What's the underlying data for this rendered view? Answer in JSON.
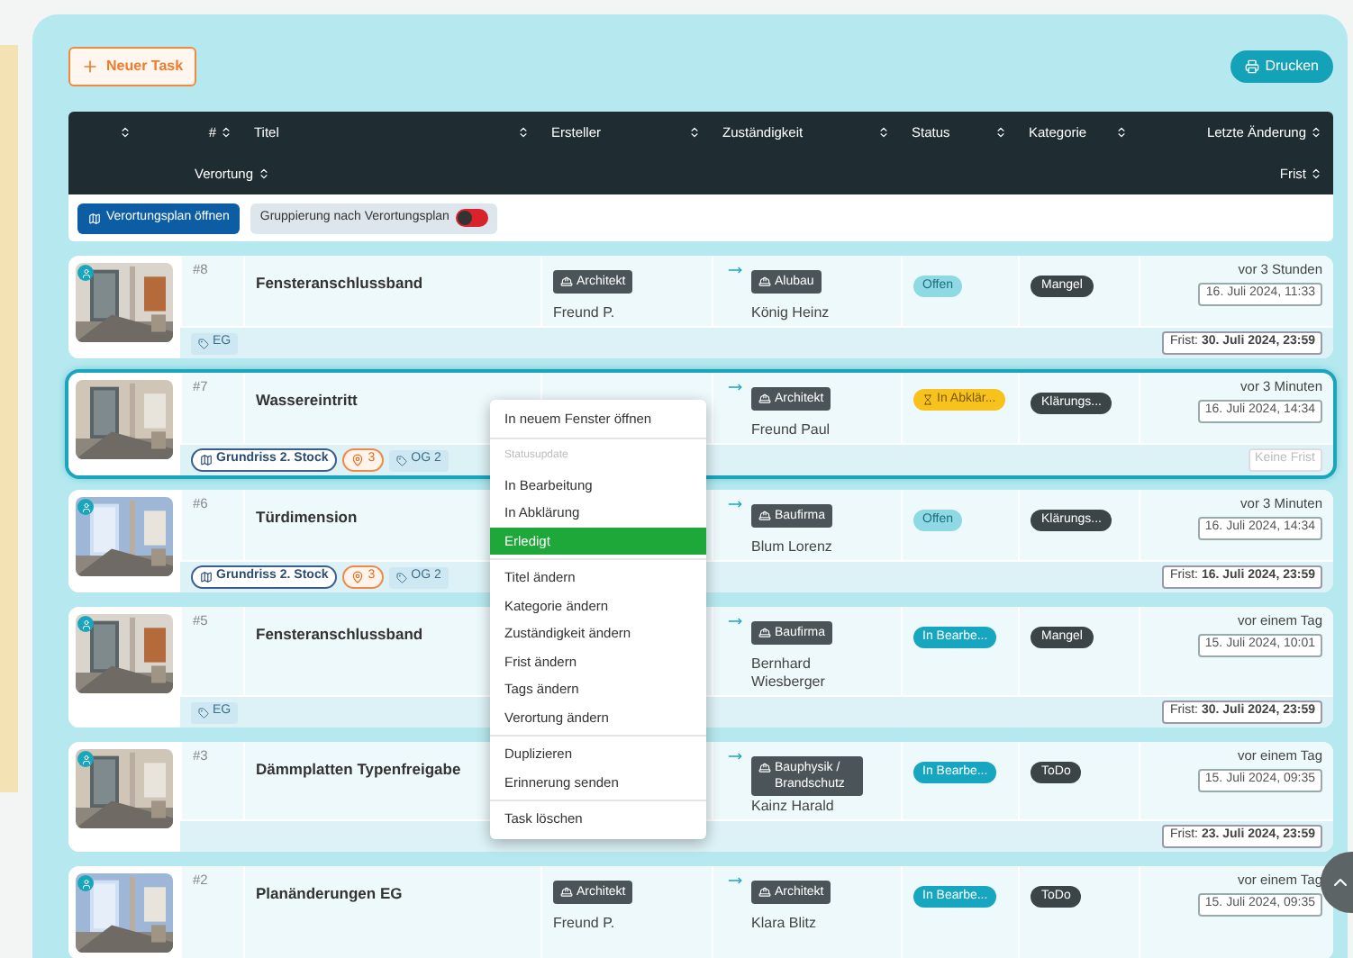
{
  "toolbar": {
    "new_task": "Neuer Task",
    "print": "Drucken"
  },
  "header": {
    "row_1": [
      {
        "kind": "sort"
      },
      {
        "label": "#",
        "kind": "sort"
      },
      {
        "label": "Titel",
        "kind": "sort"
      },
      {
        "label": "Ersteller",
        "kind": "sort"
      },
      {
        "label": "Zuständigkeit",
        "kind": "sort"
      },
      {
        "label": "Status",
        "kind": "sort"
      },
      {
        "label": "Kategorie",
        "kind": "sort"
      },
      {
        "label": "Letzte Änderung",
        "kind": "sort"
      }
    ],
    "row_2": [
      {
        "label": "Verortung"
      },
      {
        "label": "Frist"
      }
    ]
  },
  "filter_bar": {
    "plan_button": "Verortungsplan öffnen",
    "grouping": {
      "label": "Gruppierung nach Verortungsplan",
      "on": false
    }
  },
  "rows": [
    {
      "number": "#8",
      "title": "Fensteranschlussband",
      "photo": {
        "kind": "picture"
      },
      "marker": true,
      "selected": false,
      "ersteller": {
        "role": "Architekt",
        "name": "Freund P."
      },
      "zustaendigkeit": {
        "role": "Alubau",
        "name": "König Heinz"
      },
      "status": {
        "text": "Offen",
        "kind": "open"
      },
      "category": "Mangel",
      "changed": "vor 3 Stunden",
      "changed_at": "16. Juli 2024, 11:33",
      "tags": [
        {
          "kind": "tag",
          "text": "EG"
        }
      ],
      "frist": {
        "text": "Frist: **30. Juli 2024, 23:59**",
        "kind": "set"
      }
    },
    {
      "number": "#7",
      "title": "Wassereintritt",
      "photo": {
        "kind": "picture"
      },
      "marker": false,
      "selected": true,
      "zustaendigkeit": {
        "role": "Architekt",
        "name": "Freund Paul"
      },
      "status": {
        "text": "In Abklär...",
        "kind": "clarify"
      },
      "category": "Klärungs...",
      "changed": "vor 3 Minuten",
      "changed_at": "16. Juli 2024, 14:34",
      "tags": [
        {
          "kind": "plan",
          "text": "Grundriss 2. Stock"
        },
        {
          "kind": "pin",
          "text": "3"
        },
        {
          "kind": "tag",
          "text": "OG 2"
        }
      ],
      "frist": {
        "text": "Keine Frist",
        "kind": "none"
      }
    },
    {
      "number": "#6",
      "title": "Türdimension",
      "photo": {
        "kind": "picture"
      },
      "marker": true,
      "selected": false,
      "zustaendigkeit": {
        "role": "Baufirma",
        "name": "Blum Lorenz"
      },
      "status": {
        "text": "Offen",
        "kind": "open"
      },
      "category": "Klärungs...",
      "changed": "vor 3 Minuten",
      "changed_at": "16. Juli 2024, 14:34",
      "tags": [
        {
          "kind": "plan",
          "text": "Grundriss 2. Stock"
        },
        {
          "kind": "pin",
          "text": "3"
        },
        {
          "kind": "tag",
          "text": "OG 2"
        }
      ],
      "frist": {
        "text": "Frist: **16. Juli 2024, 23:59**",
        "kind": "set"
      }
    },
    {
      "number": "#5",
      "title": "Fensteranschlussband",
      "photo": {
        "kind": "picture"
      },
      "marker": true,
      "selected": false,
      "zustaendigkeit": {
        "role": "Baufirma",
        "name": "Bernhard Wiesberger"
      },
      "status": {
        "text": "In Bearbe...",
        "kind": "progress"
      },
      "category": "Mangel",
      "changed": "vor einem Tag",
      "changed_at": "15. Juli 2024, 10:01",
      "tags": [
        {
          "kind": "tag",
          "text": "EG"
        }
      ],
      "frist": {
        "text": "Frist: **30. Juli 2024, 23:59**",
        "kind": "set"
      }
    },
    {
      "number": "#3",
      "title": "Dämmplatten Typenfreigabe",
      "photo": {
        "kind": "picture"
      },
      "marker": true,
      "selected": false,
      "zustaendigkeit": {
        "role": "Bauphysik / Brandschutz",
        "name": "Kainz Harald"
      },
      "status": {
        "text": "In Bearbe...",
        "kind": "progress"
      },
      "category": "ToDo",
      "changed": "vor einem Tag",
      "changed_at": "15. Juli 2024, 09:35",
      "frist": {
        "text": "Frist: **23. Juli 2024, 23:59**",
        "kind": "set"
      }
    },
    {
      "number": "#2",
      "title": "Planänderungen EG",
      "photo": {
        "kind": "picture"
      },
      "marker": true,
      "selected": false,
      "ersteller": {
        "role": "Architekt",
        "name": "Freund P."
      },
      "zustaendigkeit": {
        "role": "Architekt",
        "name": "Klara Blitz"
      },
      "status": {
        "text": "In Bearbe...",
        "kind": "progress"
      },
      "category": "ToDo",
      "changed": "vor einem Tag",
      "changed_at": "15. Juli 2024, 09:35"
    }
  ],
  "context_menu": {
    "groups": [
      {
        "items": [
          {
            "label": "In neuem Fenster öffnen",
            "selected": false
          }
        ]
      },
      {
        "heading": "Statusupdate",
        "items": [
          {
            "label": "In Bearbeitung",
            "selected": false
          },
          {
            "label": "In Abklärung",
            "selected": false
          },
          {
            "label": "Erledigt",
            "selected": true
          }
        ]
      },
      {
        "items": [
          {
            "label": "Titel ändern",
            "selected": false
          },
          {
            "label": "Kategorie ändern",
            "selected": false
          },
          {
            "label": "Zuständigkeit ändern",
            "selected": false
          },
          {
            "label": "Frist ändern",
            "selected": false
          },
          {
            "label": "Tags ändern",
            "selected": false
          },
          {
            "label": "Verortung ändern",
            "selected": false
          }
        ]
      },
      {
        "items": [
          {
            "label": "Duplizieren",
            "selected": false
          },
          {
            "label": "Erinnerung senden",
            "selected": false
          }
        ]
      },
      {
        "items": [
          {
            "label": "Task löschen",
            "selected": false
          }
        ]
      }
    ]
  }
}
